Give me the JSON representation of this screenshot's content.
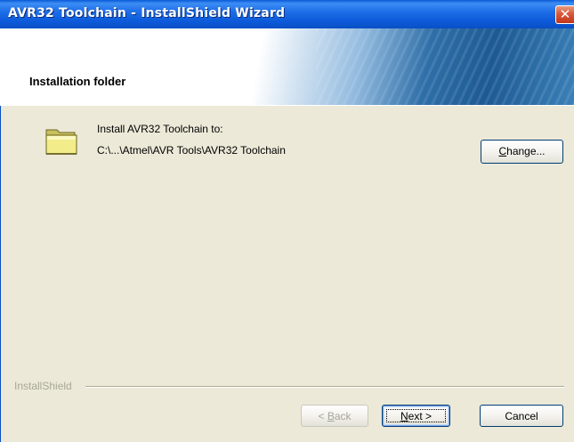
{
  "window": {
    "title": "AVR32 Toolchain - InstallShield Wizard",
    "close_glyph": "✕"
  },
  "banner": {
    "title": "Installation folder"
  },
  "content": {
    "install_label": "Install AVR32 Toolchain to:",
    "install_path": "C:\\...\\Atmel\\AVR Tools\\AVR32 Toolchain",
    "folder_icon": "folder-icon",
    "change_button": {
      "mnemonic": "C",
      "rest": "hange..."
    }
  },
  "footer": {
    "brand": "InstallShield",
    "back_button": {
      "prefix": "< ",
      "mnemonic": "B",
      "rest": "ack"
    },
    "next_button": {
      "mnemonic": "N",
      "rest": "ext >"
    },
    "cancel_button": "Cancel"
  },
  "colors": {
    "titlebar": "#0a5bd6",
    "dialog_bg": "#ece9d8",
    "close_button": "#d9583a"
  }
}
